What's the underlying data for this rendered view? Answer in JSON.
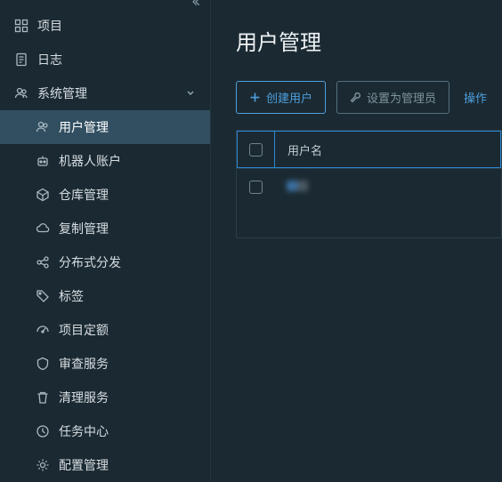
{
  "sidebar": {
    "items": [
      {
        "label": "项目",
        "icon": "grid"
      },
      {
        "label": "日志",
        "icon": "document"
      },
      {
        "label": "系统管理",
        "icon": "users",
        "expanded": true,
        "children": [
          {
            "label": "用户管理",
            "icon": "users-small",
            "active": true
          },
          {
            "label": "机器人账户",
            "icon": "robot"
          },
          {
            "label": "仓库管理",
            "icon": "cube"
          },
          {
            "label": "复制管理",
            "icon": "cloud"
          },
          {
            "label": "分布式分发",
            "icon": "share"
          },
          {
            "label": "标签",
            "icon": "tag"
          },
          {
            "label": "项目定额",
            "icon": "gauge"
          },
          {
            "label": "审查服务",
            "icon": "shield"
          },
          {
            "label": "清理服务",
            "icon": "trash"
          },
          {
            "label": "任务中心",
            "icon": "clock"
          },
          {
            "label": "配置管理",
            "icon": "gear"
          }
        ]
      }
    ]
  },
  "page": {
    "title": "用户管理"
  },
  "toolbar": {
    "create_user": "创建用户",
    "set_admin": "设置为管理员",
    "actions": "操作"
  },
  "table": {
    "columns": {
      "username": "用户名"
    },
    "rows": [
      {
        "username": "****"
      }
    ]
  }
}
